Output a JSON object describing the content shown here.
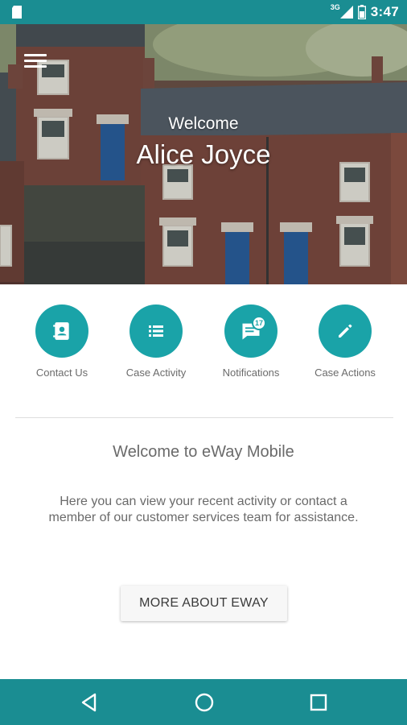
{
  "status_bar": {
    "network_label": "3G",
    "time": "3:47",
    "icons": [
      "sd-card-icon",
      "signal-icon",
      "battery-icon"
    ]
  },
  "hero": {
    "greeting": "Welcome",
    "user_name": "Alice Joyce",
    "menu_icon": "hamburger-menu-icon"
  },
  "actions": [
    {
      "label": "Contact Us",
      "icon": "contact-card-icon"
    },
    {
      "label": "Case Activity",
      "icon": "list-icon"
    },
    {
      "label": "Notifications",
      "icon": "chat-bubble-icon",
      "badge": "17"
    },
    {
      "label": "Case Actions",
      "icon": "pencil-icon"
    }
  ],
  "intro": {
    "title": "Welcome to eWay Mobile",
    "body": "Here you can view your recent activity or contact a member of our customer services team for assistance."
  },
  "more_button": {
    "label": "MORE ABOUT EWAY"
  },
  "nav_bar": {
    "icons": [
      "back-icon",
      "home-icon",
      "recents-icon"
    ]
  },
  "colors": {
    "status_bar": "#1a8d92",
    "accent": "#1aa3a8",
    "text_muted": "#6a6a6a"
  }
}
